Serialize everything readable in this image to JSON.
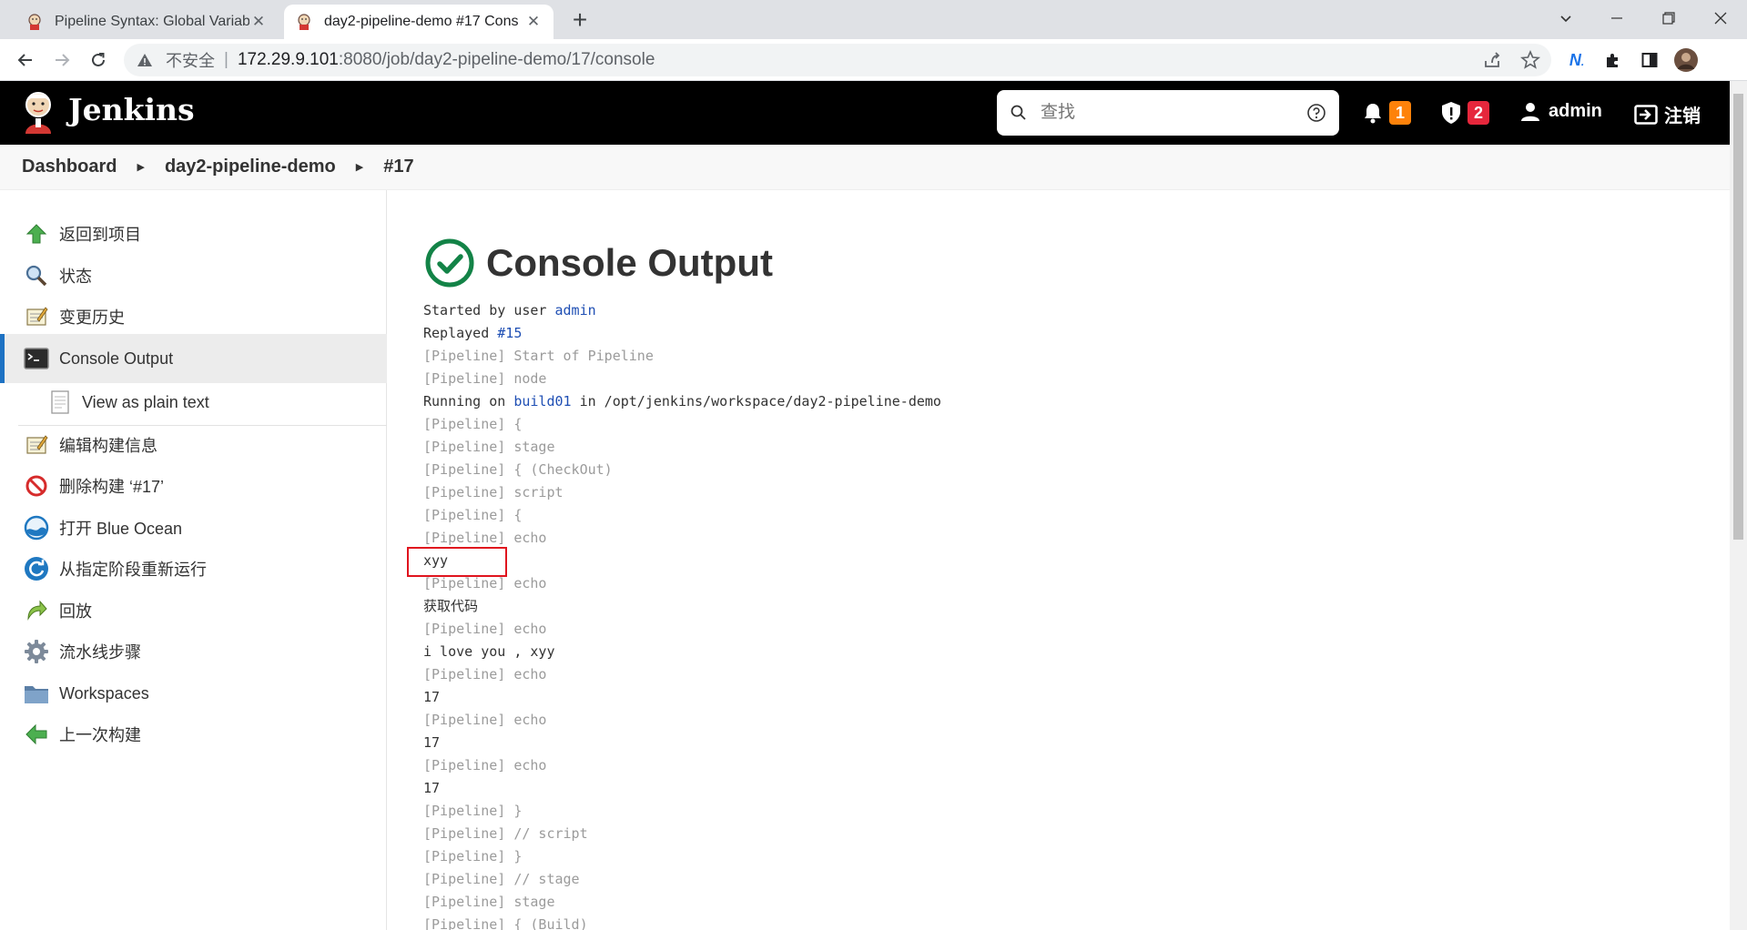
{
  "browser": {
    "tabs": [
      {
        "title": "Pipeline Syntax: Global Variable",
        "active": false
      },
      {
        "title": "day2-pipeline-demo #17 Cons",
        "active": true
      }
    ],
    "new_tab_label": "+",
    "security_label": "不安全",
    "url_host": "172.29.9.101",
    "url_path": ":8080/job/day2-pipeline-demo/17/console",
    "window_controls": [
      "chevron-down",
      "minimize",
      "restore",
      "close"
    ]
  },
  "header": {
    "app_name": "Jenkins",
    "search_placeholder": "查找",
    "notifications_count": "1",
    "security_count": "2",
    "user": "admin",
    "logout_label": "注销",
    "colors": {
      "header_bg": "#000000",
      "notification_badge": "#fe820a",
      "security_badge": "#e6273c"
    }
  },
  "breadcrumb": [
    "Dashboard",
    "day2-pipeline-demo",
    "#17"
  ],
  "sidebar": {
    "items": [
      {
        "label": "返回到项目",
        "icon": "up-arrow-icon"
      },
      {
        "label": "状态",
        "icon": "magnifier-icon"
      },
      {
        "label": "变更历史",
        "icon": "notepad-icon"
      },
      {
        "label": "Console Output",
        "icon": "terminal-icon",
        "active": true
      },
      {
        "label": "View as plain text",
        "icon": "document-icon"
      },
      {
        "label": "编辑构建信息",
        "icon": "notepad-icon"
      },
      {
        "label": "删除构建 ‘#17’",
        "icon": "no-entry-icon"
      },
      {
        "label": "打开 Blue Ocean",
        "icon": "blue-ocean-icon"
      },
      {
        "label": "从指定阶段重新运行",
        "icon": "restart-icon"
      },
      {
        "label": "回放",
        "icon": "replay-arrow-icon"
      },
      {
        "label": "流水线步骤",
        "icon": "gear-icon"
      },
      {
        "label": "Workspaces",
        "icon": "folder-icon"
      },
      {
        "label": "上一次构建",
        "icon": "back-arrow-icon"
      }
    ]
  },
  "console": {
    "title": "Console Output",
    "status": "success",
    "lines": {
      "started_prefix": "Started by user ",
      "started_user": "admin",
      "replayed_prefix": "Replayed ",
      "replayed_link": "#15",
      "l3": "[Pipeline] Start of Pipeline",
      "l4": "[Pipeline] node",
      "running_prefix": "Running on ",
      "running_node": "build01",
      "running_suffix": " in /opt/jenkins/workspace/day2-pipeline-demo",
      "l6": "[Pipeline] {",
      "l7": "[Pipeline] stage",
      "l8": "[Pipeline] { (CheckOut)",
      "l9": "[Pipeline] script",
      "l10": "[Pipeline] {",
      "l11": "[Pipeline] echo",
      "l12": "xyy",
      "l13": "[Pipeline] echo",
      "l14": "获取代码",
      "l15": "[Pipeline] echo",
      "l16": "i love you , xyy",
      "l17": "[Pipeline] echo",
      "l18": "17",
      "l19": "[Pipeline] echo",
      "l20": "17",
      "l21": "[Pipeline] echo",
      "l22": "17",
      "l23": "[Pipeline] }",
      "l24": "[Pipeline] // script",
      "l25": "[Pipeline] }",
      "l26": "[Pipeline] // stage",
      "l27": "[Pipeline] stage",
      "l28": "[Pipeline] { (Build)"
    }
  }
}
